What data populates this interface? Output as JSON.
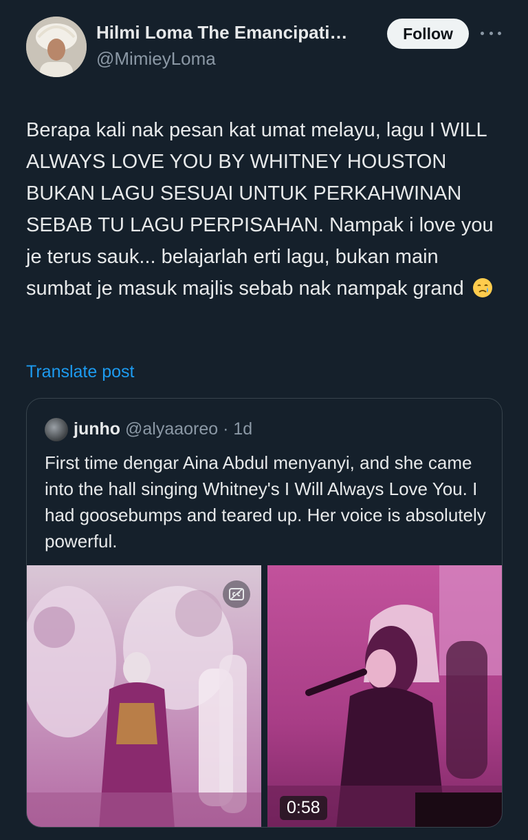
{
  "author": {
    "display_name": "Hilmi Loma The Emancipati…",
    "handle": "@MimieyLoma",
    "avatar_icon": "profile-avatar-icon"
  },
  "header": {
    "follow_label": "Follow",
    "more_icon": "more-horizontal-icon"
  },
  "post": {
    "text": "Berapa kali nak pesan kat umat melayu, lagu I WILL ALWAYS LOVE YOU BY WHITNEY HOUSTON BUKAN LAGU SESUAI UNTUK PERKAHWINAN SEBAB TU LAGU PERPISAHAN. Nampak i love you je terus sauk... belajarlah erti lagu, bukan main sumbat je masuk majlis sebab nak nampak grand",
    "emoji": "crying-face-emoji",
    "translate_label": "Translate post"
  },
  "quoted_post": {
    "name": "junho",
    "handle": "@alyaaoreo",
    "separator": "·",
    "time": "1d",
    "text": "First time dengar Aina Abdul menyanyi, and she came into the hall singing Whitney's I Will Always Love You. I had goosebumps and teared up. Her voice is absolutely powerful.",
    "media": [
      {
        "kind": "image",
        "icon": "captions-icon"
      },
      {
        "kind": "video",
        "duration": "0:58"
      }
    ]
  },
  "colors": {
    "background": "#15202b",
    "text_primary": "#e7e9ea",
    "text_secondary": "#8b98a5",
    "link": "#1d9bf0",
    "border": "#38444d"
  }
}
